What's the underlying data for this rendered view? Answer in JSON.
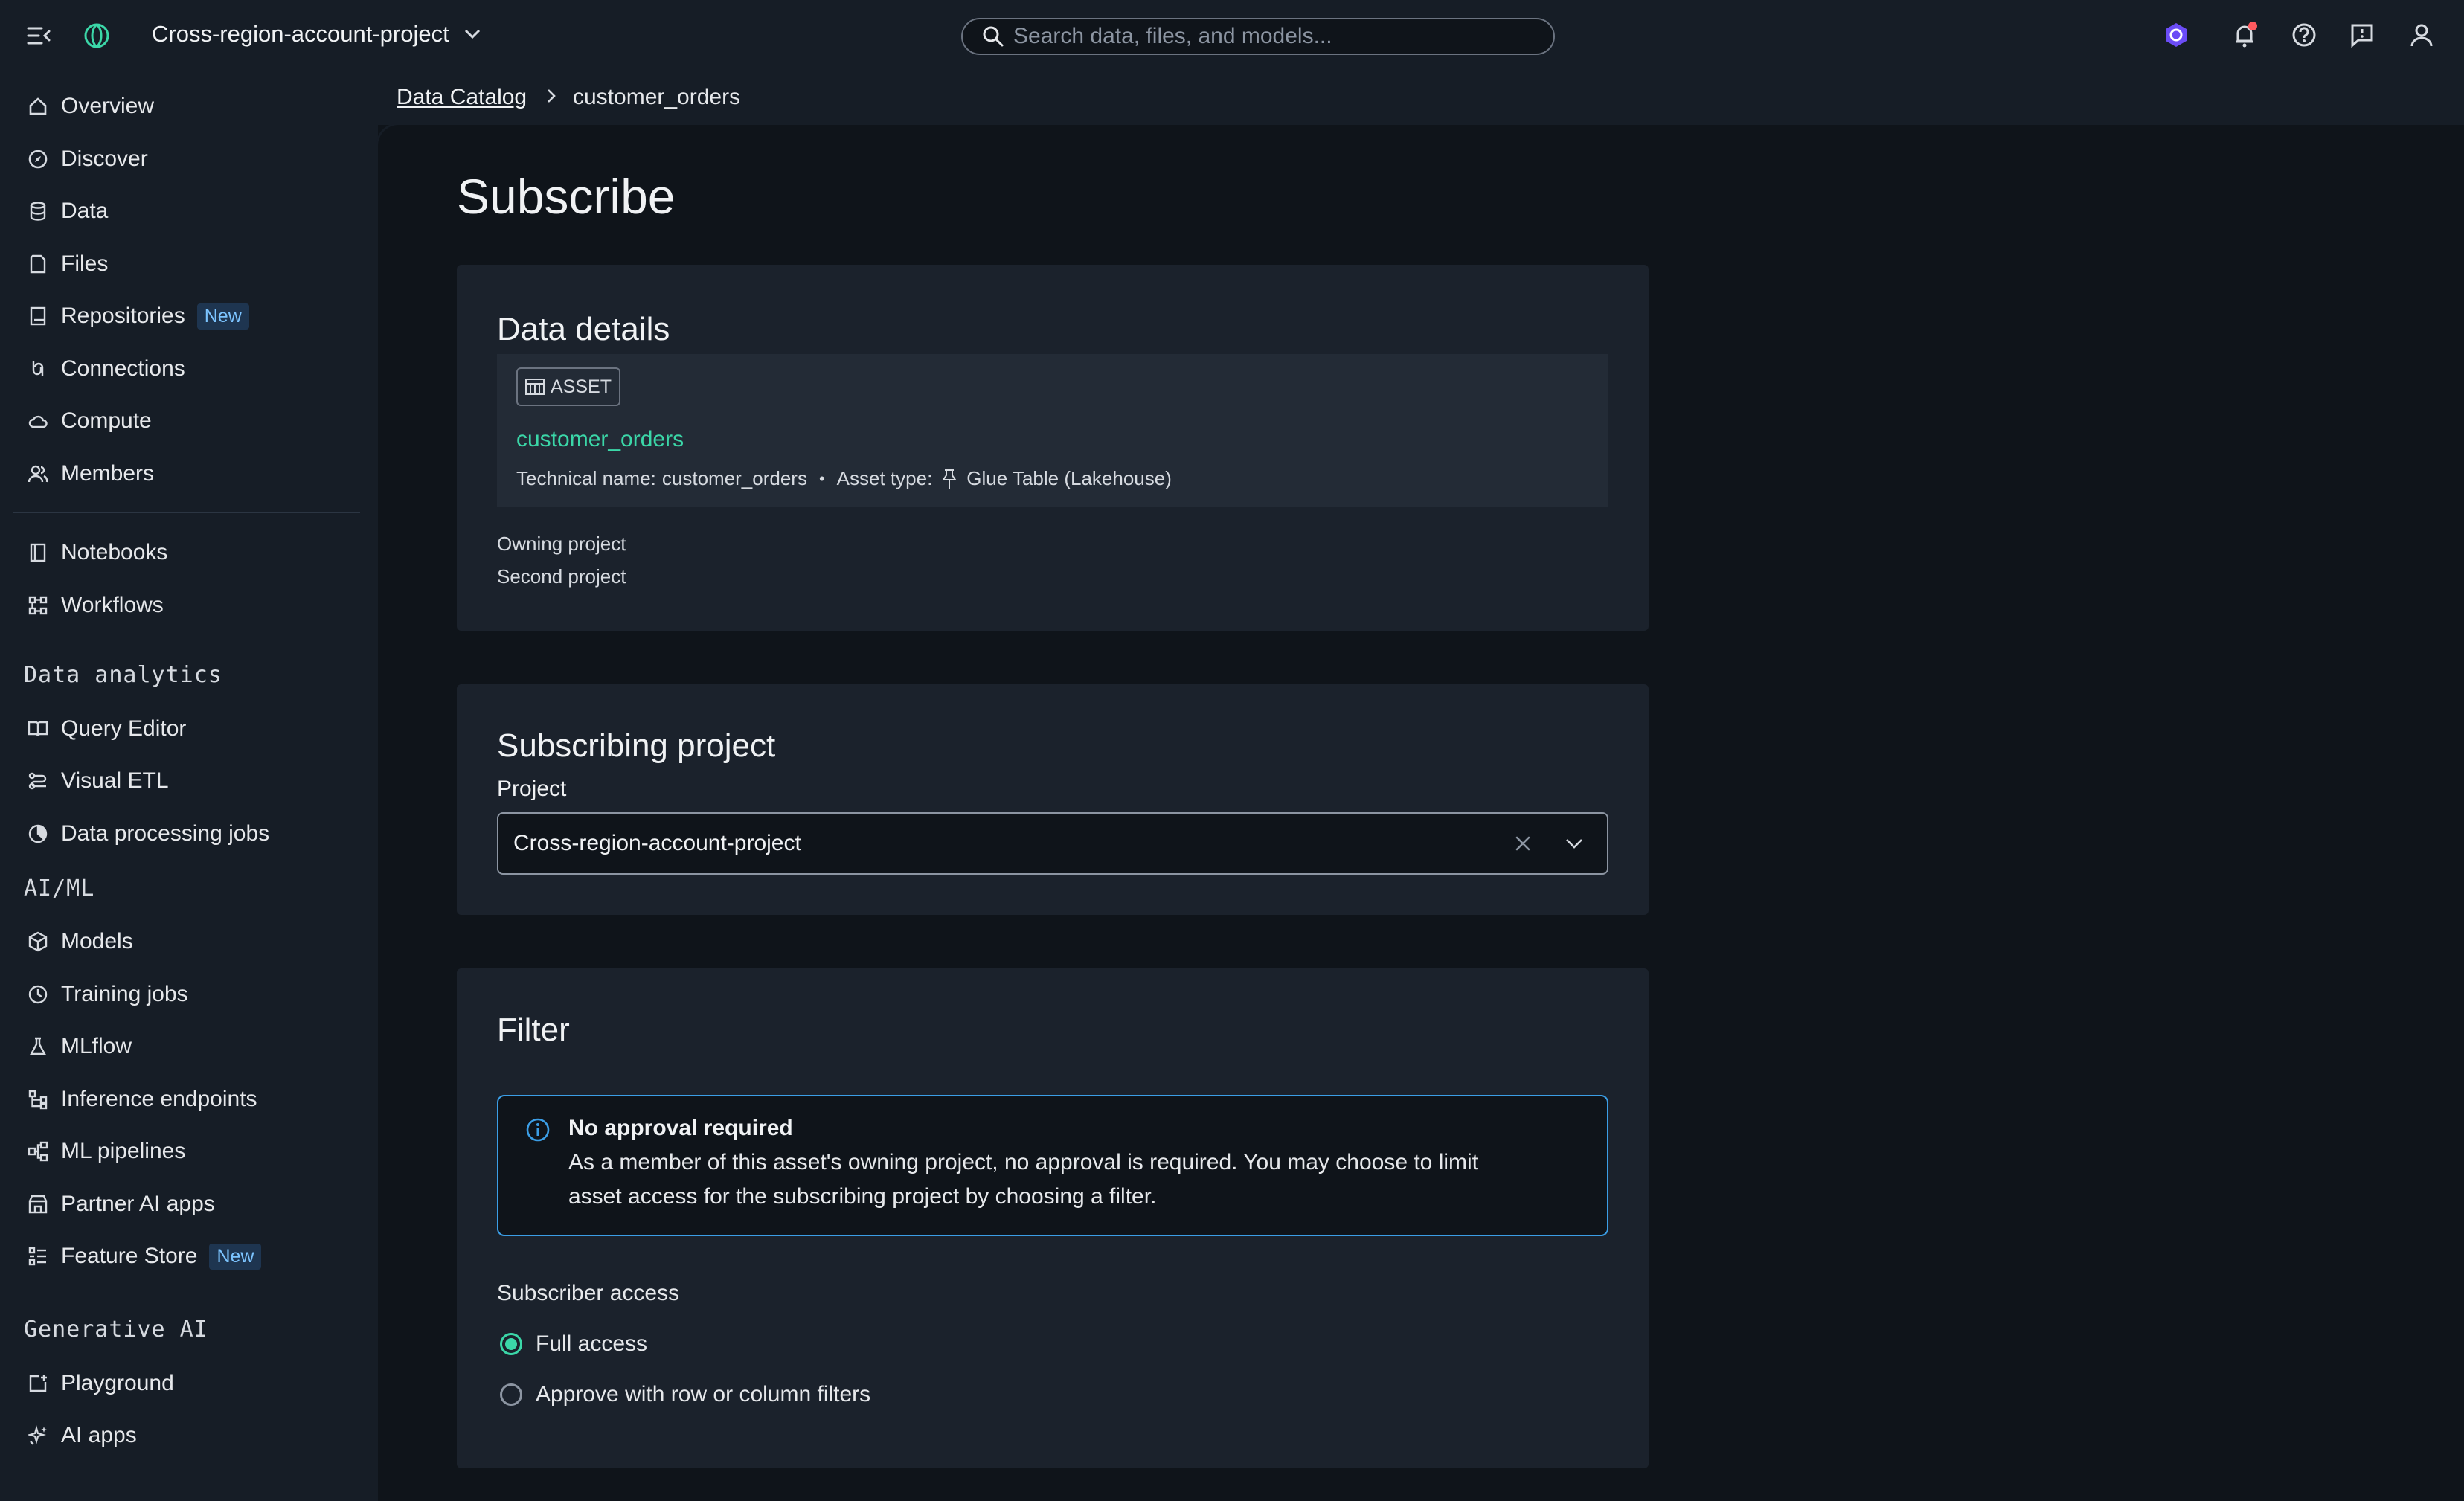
{
  "header": {
    "project_name": "Cross-region-account-project",
    "search_placeholder": "Search data, files, and models..."
  },
  "sidebar": {
    "items": [
      {
        "label": "Overview"
      },
      {
        "label": "Discover"
      },
      {
        "label": "Data"
      },
      {
        "label": "Files"
      },
      {
        "label": "Repositories",
        "badge": "New"
      },
      {
        "label": "Connections"
      },
      {
        "label": "Compute"
      },
      {
        "label": "Members"
      },
      {
        "label": "Notebooks"
      },
      {
        "label": "Workflows"
      }
    ],
    "sections": [
      {
        "title": "Data analytics",
        "items": [
          {
            "label": "Query Editor"
          },
          {
            "label": "Visual ETL"
          },
          {
            "label": "Data processing jobs"
          }
        ]
      },
      {
        "title": "AI/ML",
        "items": [
          {
            "label": "Models"
          },
          {
            "label": "Training jobs"
          },
          {
            "label": "MLflow"
          },
          {
            "label": "Inference endpoints"
          },
          {
            "label": "ML pipelines"
          },
          {
            "label": "Partner AI apps"
          },
          {
            "label": "Feature Store",
            "badge": "New"
          }
        ]
      },
      {
        "title": "Generative AI",
        "items": [
          {
            "label": "Playground"
          },
          {
            "label": "AI apps"
          }
        ]
      }
    ]
  },
  "breadcrumb": {
    "parent": "Data Catalog",
    "current": "customer_orders"
  },
  "page": {
    "title": "Subscribe",
    "data_details": {
      "heading": "Data details",
      "tag": "ASSET",
      "asset_name": "customer_orders",
      "technical_name_label": "Technical name:",
      "technical_name": "customer_orders",
      "asset_type_label": "Asset type:",
      "asset_type": "Glue Table (Lakehouse)",
      "owning_project_label": "Owning project",
      "owning_project": "Second project"
    },
    "subscribing_project": {
      "heading": "Subscribing project",
      "project_label": "Project",
      "project_value": "Cross-region-account-project"
    },
    "filter": {
      "heading": "Filter",
      "alert_title": "No approval required",
      "alert_line1": "As a member of this asset's owning project, no approval is required. You may choose to limit",
      "alert_line2": "asset access for the subscribing project by choosing a filter.",
      "access_label": "Subscriber access",
      "options": [
        {
          "label": "Full access",
          "selected": true
        },
        {
          "label": "Approve with row or column filters",
          "selected": false
        }
      ]
    }
  },
  "colors": {
    "accent": "#3bd7a8",
    "info": "#3b9ee6",
    "badge": "#7cc4ff",
    "notification": "#ff5a5f"
  }
}
